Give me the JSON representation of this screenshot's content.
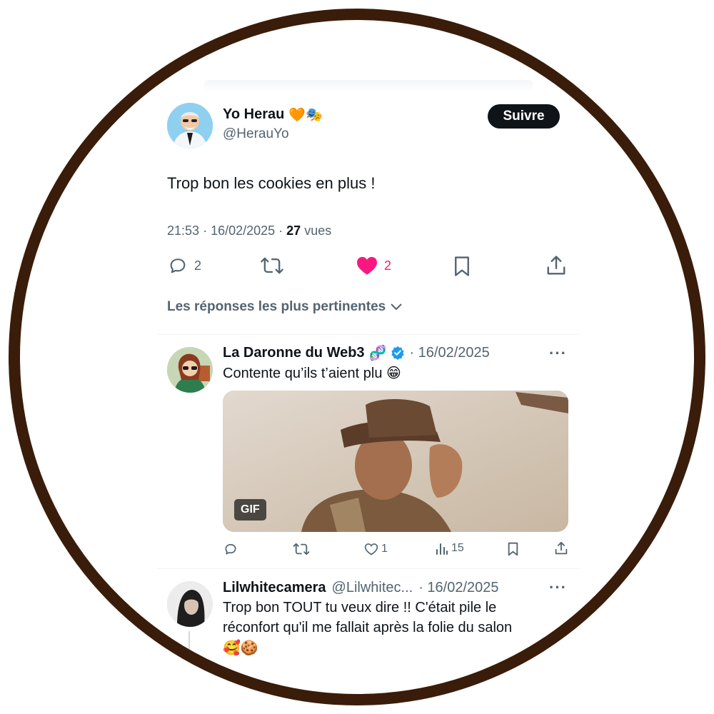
{
  "main_tweet": {
    "author_name": "Yo Herau",
    "author_emojis": "🧡🎭",
    "handle": "@HerauYo",
    "follow_label": "Suivre",
    "text": "Trop bon les cookies en plus !",
    "time": "21:53",
    "date": "16/02/2025",
    "views_count": "27",
    "views_label": "vues",
    "reply_count": "2",
    "like_count": "2",
    "liked": true
  },
  "replies_sort_label": "Les réponses les plus pertinentes",
  "replies": [
    {
      "author_name": "La Daronne du Web3",
      "author_emoji": "🧬",
      "verified": true,
      "date": "· 16/02/2025",
      "text": "Contente qu’ils t’aient plu 😁",
      "media_badge": "GIF",
      "like_count": "1",
      "views_count": "15"
    },
    {
      "author_name": "Lilwhitecamera",
      "handle": "@Lilwhitec...",
      "date": "· 16/02/2025",
      "text_line1": "Trop bon TOUT tu veux dire !! C'était pile le",
      "text_line2": "réconfort qu'il me fallait après la folie du salon",
      "text_line3": "🥰🍪"
    }
  ],
  "colors": {
    "like_pink": "#f91880",
    "verified_blue": "#1d9bf0",
    "follow_bg": "#0f1419",
    "ring": "#3a1c0a"
  }
}
